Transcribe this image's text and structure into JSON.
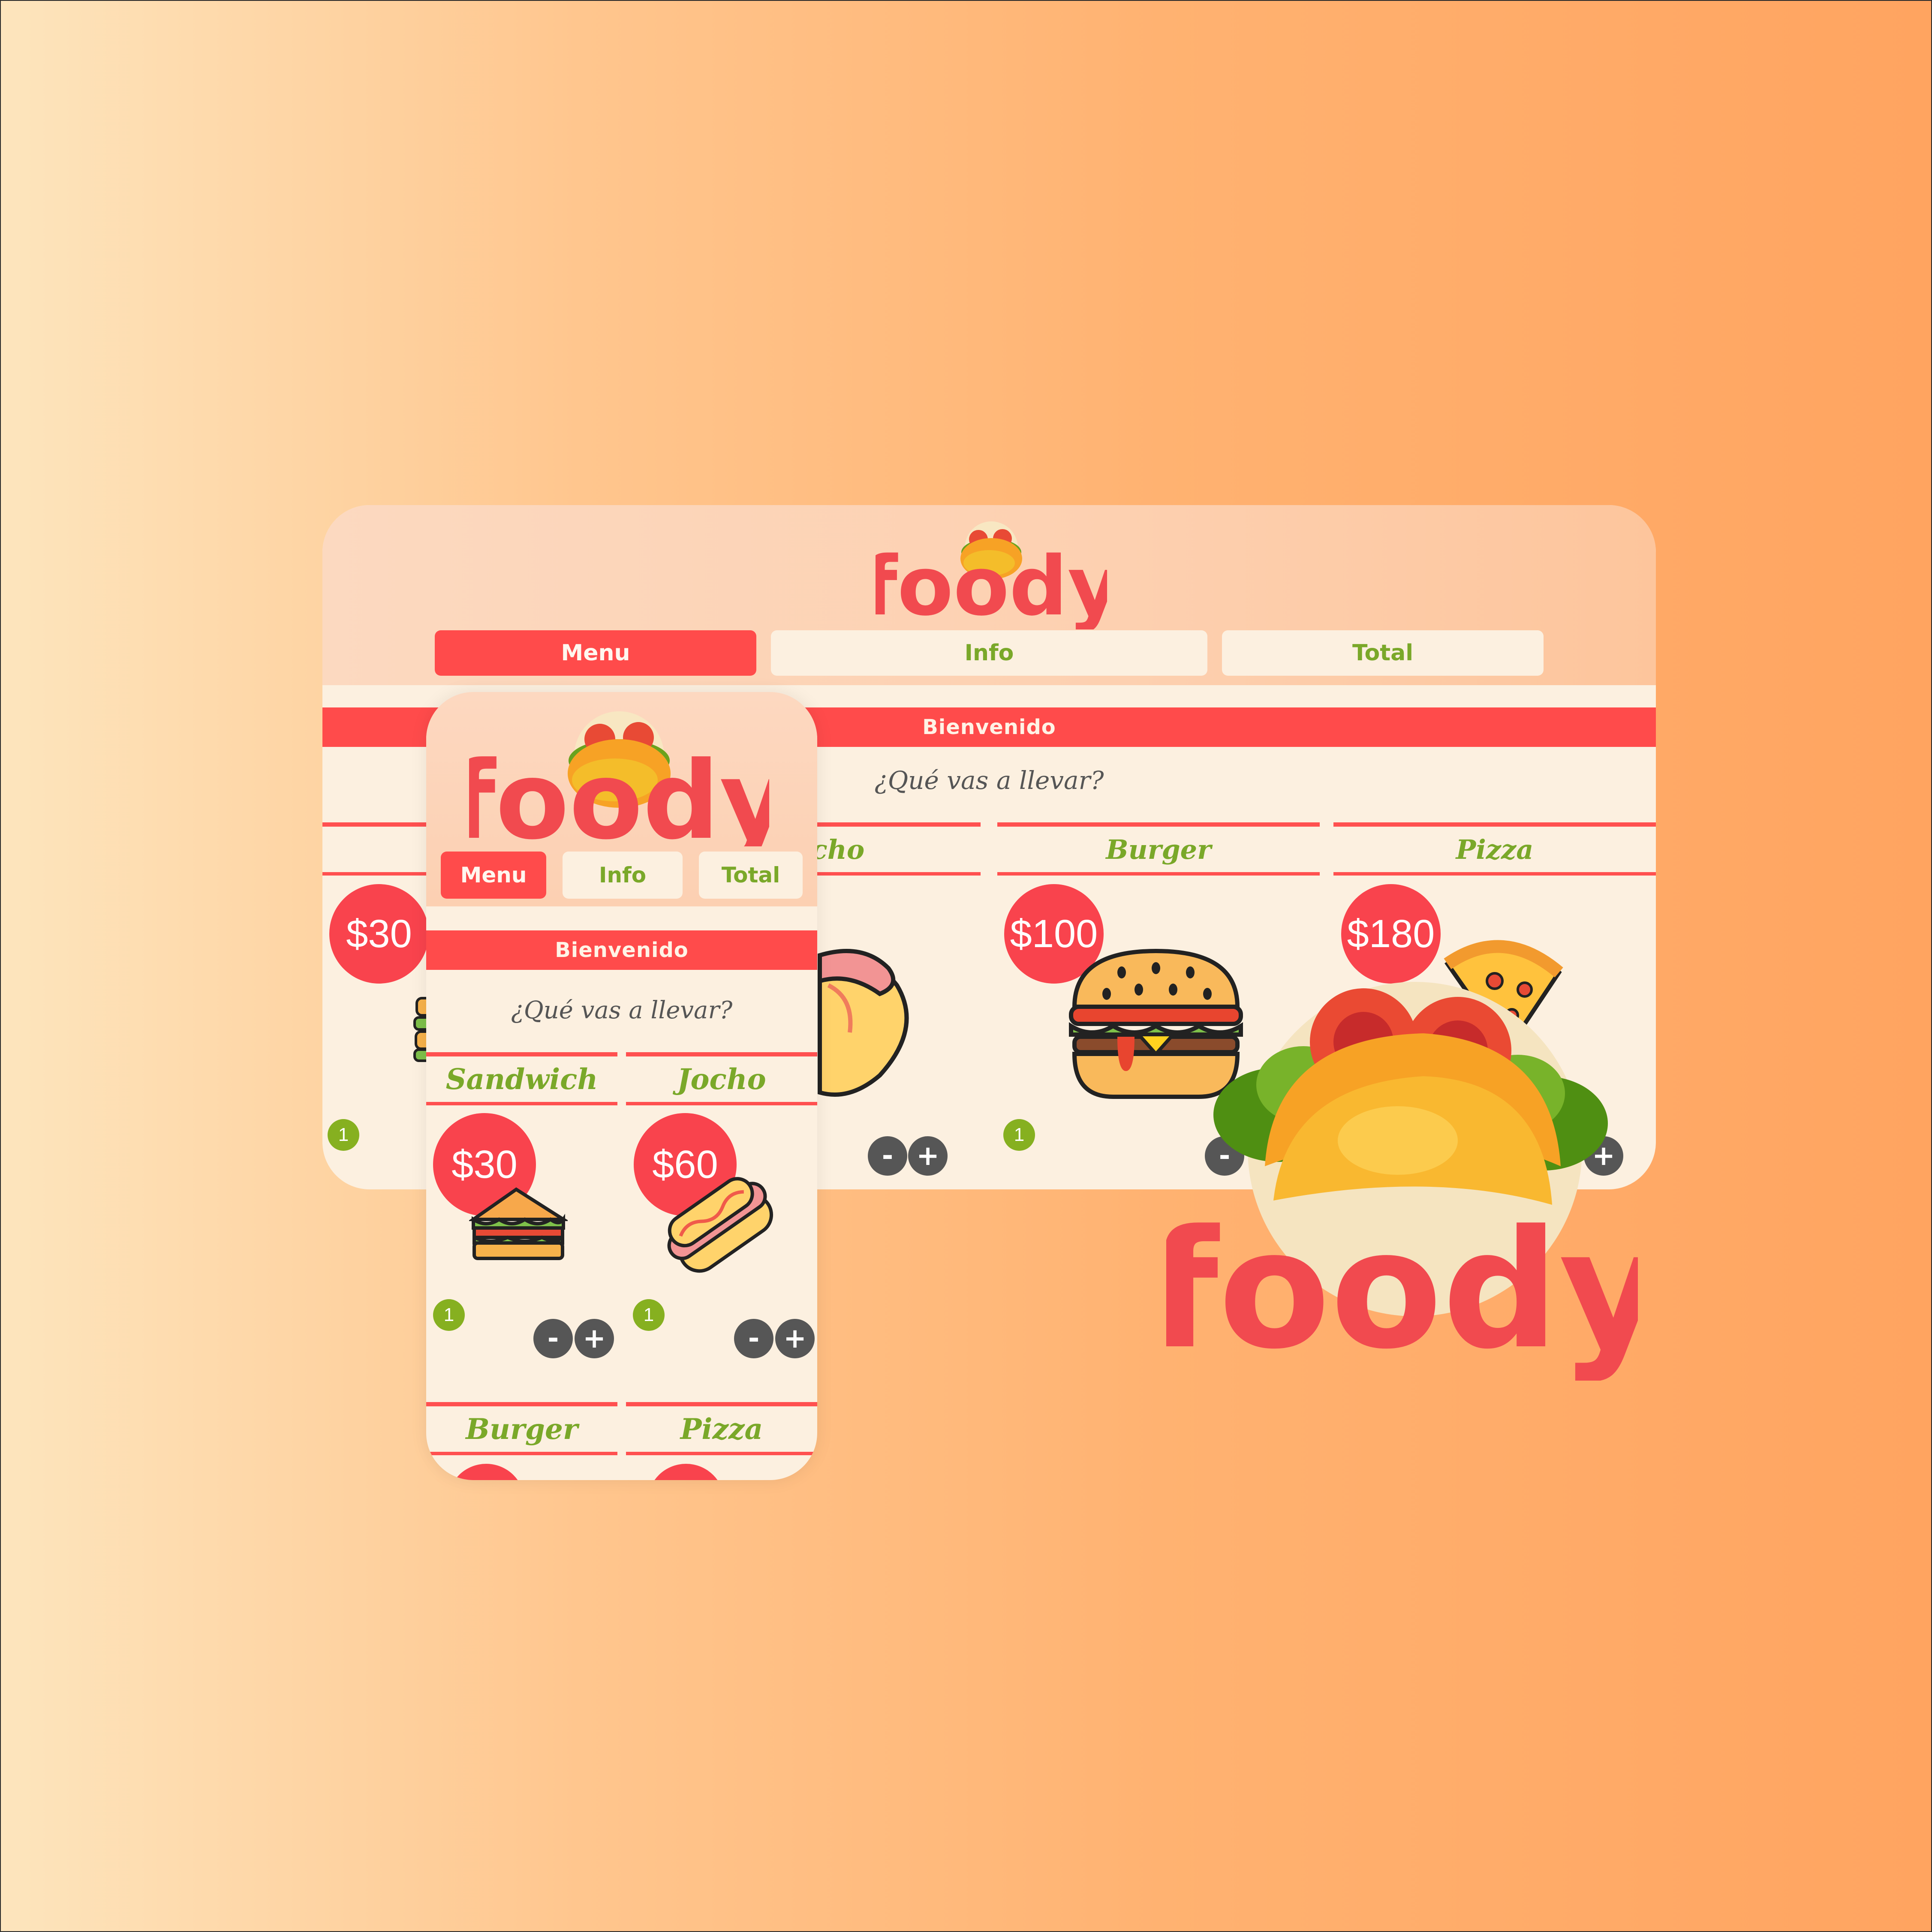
{
  "brand": "foody",
  "colors": {
    "accent": "#ff4b4b",
    "green": "#7aa829",
    "cream": "#fcf0e0",
    "button": "#565656"
  },
  "nav": {
    "menu": "Menu",
    "info": "Info",
    "total": "Total"
  },
  "welcome": "Bienvenido",
  "question": "¿Qué vas a llevar?",
  "desktop": {
    "items": [
      {
        "name": "",
        "price": "$30",
        "qty": "1",
        "icon": "sandwich-icon"
      },
      {
        "name": "cho",
        "price": "",
        "qty": "",
        "icon": "hotdog-icon"
      },
      {
        "name": "Burger",
        "price": "$100",
        "qty": "1",
        "icon": "burger-icon"
      },
      {
        "name": "Pizza",
        "price": "$180",
        "qty": "",
        "icon": "pizza-icon"
      }
    ]
  },
  "mobile": {
    "items": [
      {
        "name": "Sandwich",
        "price": "$30",
        "qty": "1",
        "icon": "sandwich-icon"
      },
      {
        "name": "Jocho",
        "price": "$60",
        "qty": "1",
        "icon": "hotdog-icon"
      },
      {
        "name": "Burger",
        "icon": "burger-icon"
      },
      {
        "name": "Pizza",
        "icon": "pizza-icon"
      }
    ]
  },
  "controls": {
    "minus": "-",
    "plus": "+"
  }
}
